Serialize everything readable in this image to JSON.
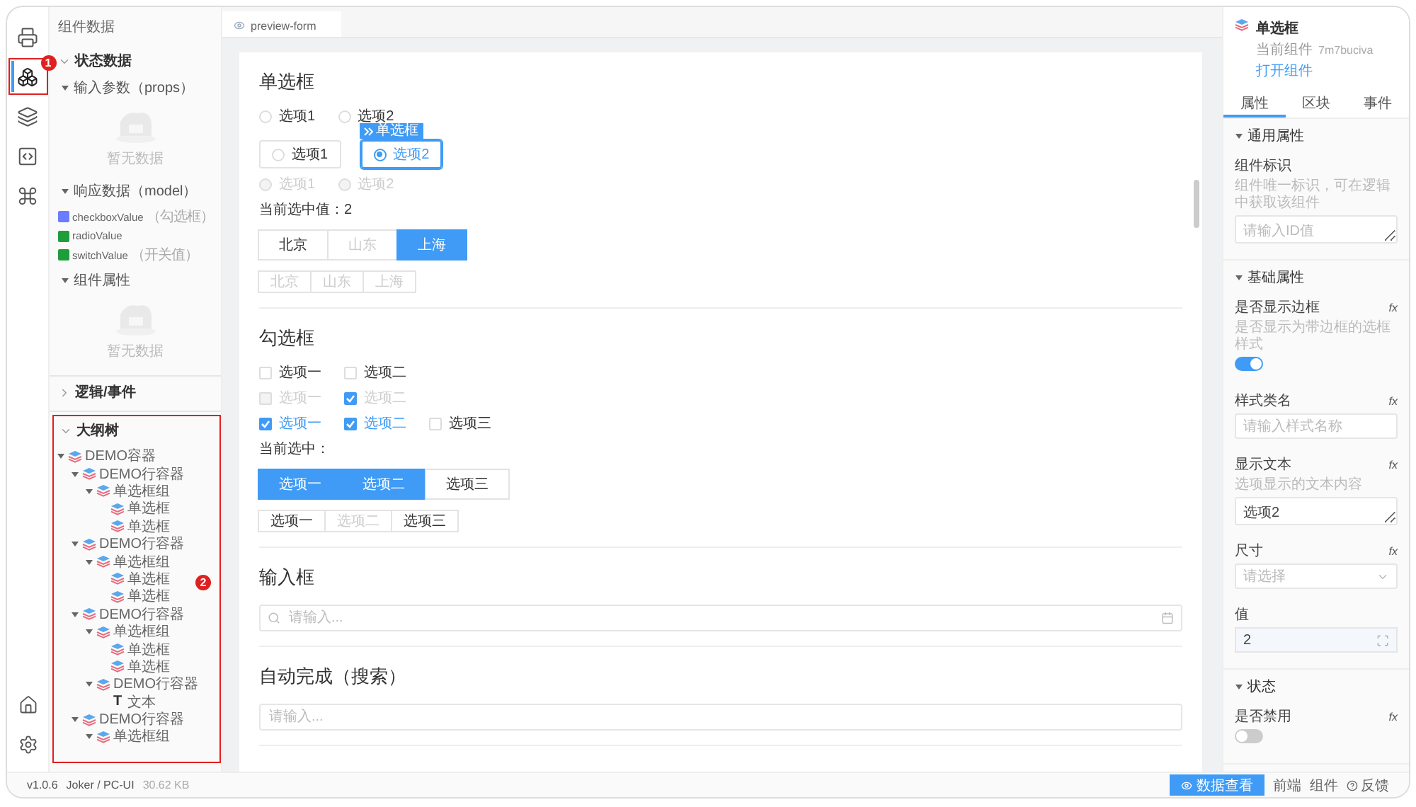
{
  "rail": {
    "items": [
      {
        "selected": false
      },
      {
        "selected": true,
        "annotation": "1"
      },
      {
        "selected": false
      },
      {
        "selected": false
      },
      {
        "selected": false
      }
    ]
  },
  "data_panel": {
    "title": "组件数据",
    "state_section": {
      "title": "状态数据",
      "expanded": true,
      "groups": [
        {
          "title": "输入参数（props）",
          "expanded": true,
          "empty_text": "暂无数据"
        },
        {
          "title": "响应数据（model）",
          "expanded": true,
          "items": [
            {
              "name": "checkboxValue",
              "note": "（勾选框）",
              "color": "#6b7cff"
            },
            {
              "name": "radioValue",
              "color": "#1f9d3a"
            },
            {
              "name": "switchValue",
              "note": "（开关值）",
              "color": "#1f9d3a"
            }
          ]
        },
        {
          "title": "组件属性",
          "expanded": true,
          "empty_text": "暂无数据"
        }
      ]
    },
    "logic_section": {
      "title": "逻辑/事件",
      "expanded": false
    },
    "outline_section": {
      "title": "大纲树",
      "expanded": true,
      "annotation": "2",
      "tree": [
        {
          "label": "DEMO容器",
          "kind": "container",
          "expanded": true,
          "children": [
            {
              "label": "DEMO行容器",
              "kind": "container",
              "expanded": true,
              "children": [
                {
                  "label": "单选框组",
                  "kind": "container",
                  "expanded": true,
                  "children": [
                    {
                      "label": "单选框",
                      "kind": "container"
                    },
                    {
                      "label": "单选框",
                      "kind": "container"
                    }
                  ]
                }
              ]
            },
            {
              "label": "DEMO行容器",
              "kind": "container",
              "expanded": true,
              "children": [
                {
                  "label": "单选框组",
                  "kind": "container",
                  "expanded": true,
                  "children": [
                    {
                      "label": "单选框",
                      "kind": "container"
                    },
                    {
                      "label": "单选框",
                      "kind": "container"
                    }
                  ]
                }
              ]
            },
            {
              "label": "DEMO行容器",
              "kind": "container",
              "expanded": true,
              "children": [
                {
                  "label": "单选框组",
                  "kind": "container",
                  "expanded": true,
                  "children": [
                    {
                      "label": "单选框",
                      "kind": "container"
                    },
                    {
                      "label": "单选框",
                      "kind": "container"
                    }
                  ]
                },
                {
                  "label": "DEMO行容器",
                  "kind": "container",
                  "expanded": true,
                  "children": [
                    {
                      "label": "文本",
                      "kind": "text",
                      "icon": "T"
                    }
                  ]
                }
              ]
            },
            {
              "label": "DEMO行容器",
              "kind": "container",
              "expanded": true,
              "children": [
                {
                  "label": "单选框组",
                  "kind": "container",
                  "expanded": true
                }
              ]
            }
          ]
        }
      ]
    }
  },
  "editor_tabs": [
    {
      "label": "preview-form",
      "selected": true
    }
  ],
  "canvas": {
    "sections": [
      {
        "title": "单选框",
        "rows": [
          {
            "kind": "radio",
            "options": [
              {
                "label": "选项1",
                "selected": false,
                "disabled": false
              },
              {
                "label": "选项2",
                "selected": false,
                "disabled": false
              }
            ]
          },
          {
            "kind": "radio_bordered",
            "options": [
              {
                "label": "选项1",
                "selected": false,
                "disabled": false
              },
              {
                "label": "选项2",
                "selected": true,
                "disabled": false,
                "focus_tag": "单选框"
              }
            ]
          },
          {
            "kind": "radio",
            "options": [
              {
                "label": "选项1",
                "selected": false,
                "disabled": true
              },
              {
                "label": "选项2",
                "selected": false,
                "disabled": true
              }
            ]
          },
          {
            "kind": "text",
            "text": "当前选中值：2"
          },
          {
            "kind": "button_group",
            "options": [
              {
                "label": "北京",
                "selected": false,
                "disabled": false
              },
              {
                "label": "山东",
                "selected": false,
                "disabled": true
              },
              {
                "label": "上海",
                "selected": true,
                "disabled": false
              }
            ]
          },
          {
            "kind": "button_group_small",
            "options": [
              {
                "label": "北京",
                "selected": false,
                "disabled": true
              },
              {
                "label": "山东",
                "selected": false,
                "disabled": true
              },
              {
                "label": "上海",
                "selected": false,
                "disabled": true
              }
            ]
          }
        ]
      },
      {
        "title": "勾选框",
        "rows": [
          {
            "kind": "checkbox",
            "options": [
              {
                "label": "选项一",
                "checked": false,
                "disabled": false
              },
              {
                "label": "选项二",
                "checked": false,
                "disabled": false
              }
            ]
          },
          {
            "kind": "checkbox",
            "options": [
              {
                "label": "选项一",
                "checked": false,
                "disabled": true
              },
              {
                "label": "选项二",
                "checked": true,
                "disabled": true
              }
            ]
          },
          {
            "kind": "checkbox",
            "options": [
              {
                "label": "选项一",
                "checked": true,
                "disabled": false
              },
              {
                "label": "选项二",
                "checked": true,
                "disabled": false
              },
              {
                "label": "选项三",
                "checked": false,
                "disabled": false
              }
            ]
          },
          {
            "kind": "text",
            "text": "当前选中："
          },
          {
            "kind": "button_group",
            "options": [
              {
                "label": "选项一",
                "selected": true,
                "disabled": false
              },
              {
                "label": "选项二",
                "selected": true,
                "disabled": false
              },
              {
                "label": "选项三",
                "selected": false,
                "disabled": false
              }
            ]
          },
          {
            "kind": "button_group_small",
            "options": [
              {
                "label": "选项一",
                "selected": false,
                "disabled": false
              },
              {
                "label": "选项二",
                "selected": false,
                "disabled": true
              },
              {
                "label": "选项三",
                "selected": false,
                "disabled": false
              }
            ]
          }
        ]
      },
      {
        "title": "输入框",
        "rows": [
          {
            "kind": "search_input",
            "placeholder": "请输入..."
          }
        ]
      },
      {
        "title": "自动完成（搜索）",
        "rows": [
          {
            "kind": "input",
            "placeholder": "请输入..."
          }
        ]
      }
    ]
  },
  "inspector": {
    "title": "单选框",
    "subtitle_label": "当前组件",
    "component_id": "7m7buciva",
    "link": "打开组件",
    "tabs": [
      {
        "label": "属性",
        "selected": true
      },
      {
        "label": "区块",
        "selected": false
      },
      {
        "label": "事件",
        "selected": false
      }
    ],
    "sections": [
      {
        "title": "通用属性",
        "expanded": true,
        "fields": [
          {
            "kind": "textarea",
            "label": "组件标识",
            "description": "组件唯一标识，可在逻辑中获取该组件",
            "placeholder": "请输入ID值"
          }
        ]
      },
      {
        "title": "基础属性",
        "expanded": true,
        "fields": [
          {
            "kind": "switch",
            "label": "是否显示边框",
            "fx": "fx",
            "description": "是否显示为带边框的选框样式",
            "on": true
          },
          {
            "kind": "input",
            "label": "样式类名",
            "fx": "fx",
            "placeholder": "请输入样式名称"
          },
          {
            "kind": "textarea",
            "label": "显示文本",
            "fx": "fx",
            "description": "选项显示的文本内容",
            "value": "选项2"
          },
          {
            "kind": "select",
            "label": "尺寸",
            "fx": "fx",
            "placeholder": "请选择"
          },
          {
            "kind": "number",
            "label": "值",
            "value": "2"
          }
        ]
      },
      {
        "title": "状态",
        "expanded": true,
        "fields": [
          {
            "kind": "switch",
            "label": "是否禁用",
            "fx": "fx",
            "on": false
          }
        ]
      }
    ]
  },
  "status_bar": {
    "version": "v1.0.6",
    "author": "Joker / PC-UI",
    "size": "30.62 KB",
    "button": "数据查看",
    "links": [
      {
        "label": "前端",
        "kind": "plain"
      },
      {
        "label": "组件",
        "kind": "plain"
      },
      {
        "label": "反馈",
        "kind": "help"
      }
    ]
  }
}
